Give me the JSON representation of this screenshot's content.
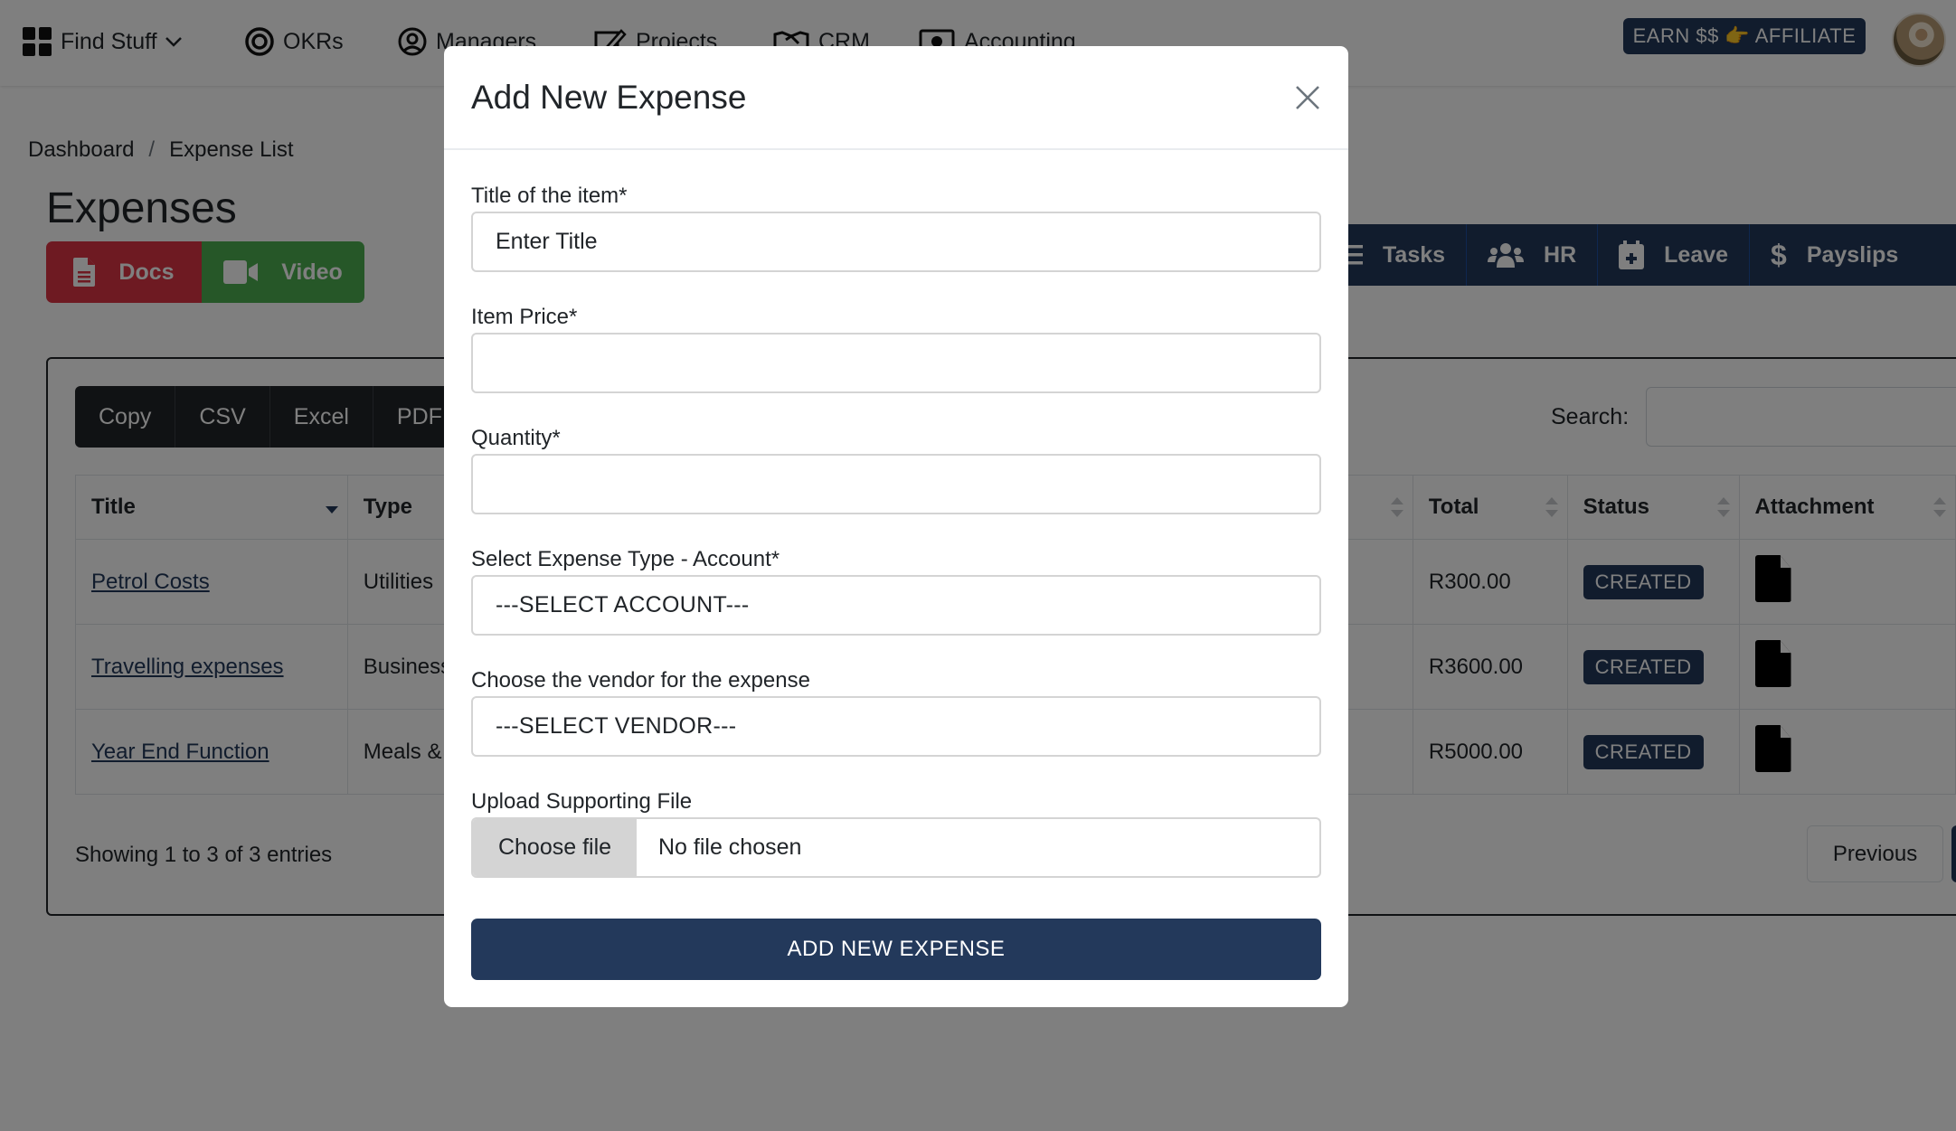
{
  "navbar": {
    "items": [
      {
        "label": "Find Stuff",
        "icon": "grid-icon"
      },
      {
        "label": "OKRs",
        "icon": "target-icon"
      },
      {
        "label": "Managers",
        "icon": "user-circle-icon"
      },
      {
        "label": "Projects",
        "icon": "edit-icon"
      },
      {
        "label": "CRM",
        "icon": "handshake-icon"
      },
      {
        "label": "Accounting",
        "icon": "money-bill-icon"
      }
    ],
    "affiliate_label": "EARN $$ 👉 AFFILIATE"
  },
  "breadcrumb": {
    "items": [
      "Dashboard",
      "Expense List"
    ],
    "separator": "/"
  },
  "page": {
    "title": "Expenses",
    "docs_label": "Docs",
    "video_label": "Video"
  },
  "quicknav": {
    "items": [
      {
        "label": "Tasks",
        "icon": "list-icon"
      },
      {
        "label": "HR",
        "icon": "users-icon"
      },
      {
        "label": "Leave",
        "icon": "calendar-plus-icon"
      },
      {
        "label": "Payslips",
        "icon": "dollar-icon"
      }
    ]
  },
  "table": {
    "export_buttons": [
      "Copy",
      "CSV",
      "Excel",
      "PDF"
    ],
    "search_label": "Search:",
    "search_value": "",
    "columns": [
      "Title",
      "Type",
      "",
      "Total",
      "Status",
      "Attachment"
    ],
    "rows": [
      {
        "title": "Petrol Costs",
        "type": "Utilities",
        "total": "R300.00",
        "status": "CREATED"
      },
      {
        "title": "Travelling expenses",
        "type": "Business",
        "total": "R3600.00",
        "status": "CREATED"
      },
      {
        "title": "Year End Function",
        "type": "Meals &",
        "total": "R5000.00",
        "status": "CREATED"
      }
    ],
    "showing": "Showing 1 to 3 of 3 entries",
    "previous_label": "Previous"
  },
  "modal": {
    "title": "Add New Expense",
    "fields": {
      "title": {
        "label": "Title of the item*",
        "placeholder": "Enter Title",
        "value": ""
      },
      "price": {
        "label": "Item Price*",
        "placeholder": "",
        "value": ""
      },
      "quantity": {
        "label": "Quantity*",
        "placeholder": "",
        "value": ""
      },
      "account": {
        "label": "Select Expense Type - Account*",
        "selected": "---SELECT ACCOUNT---"
      },
      "vendor": {
        "label": "Choose the vendor for the expense",
        "selected": "---SELECT VENDOR---"
      },
      "file": {
        "label": "Upload Supporting File",
        "button": "Choose file",
        "status": "No file chosen"
      }
    },
    "submit_label": "ADD NEW EXPENSE"
  },
  "colors": {
    "primary": "#23395b",
    "docs": "#dc3545",
    "video": "#4caf50",
    "export": "#212529"
  }
}
